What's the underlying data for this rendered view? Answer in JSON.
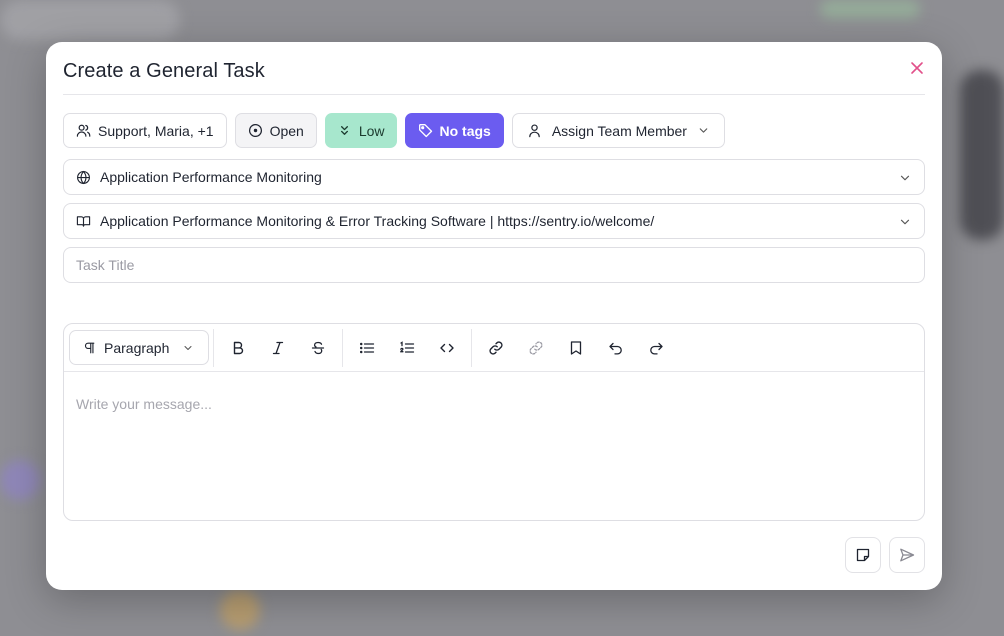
{
  "modal": {
    "title": "Create a General Task"
  },
  "chips": {
    "assignees": "Support, Maria, +1",
    "status": "Open",
    "priority": "Low",
    "tags": "No tags",
    "assign_member": "Assign Team Member"
  },
  "project_select": {
    "value": "Application Performance Monitoring",
    "icon": "globe-icon"
  },
  "source_select": {
    "value": "Application Performance Monitoring & Error Tracking Software | https://sentry.io/welcome/",
    "icon": "book-icon"
  },
  "task_title": {
    "placeholder": "Task Title",
    "value": ""
  },
  "editor": {
    "block_type": "Paragraph",
    "placeholder": "Write your message...",
    "toolbar_icons": [
      "bold-icon",
      "italic-icon",
      "strikethrough-icon",
      "bullet-list-icon",
      "ordered-list-icon",
      "code-icon",
      "link-icon",
      "unlink-icon",
      "bookmark-icon",
      "undo-icon",
      "redo-icon"
    ]
  },
  "colors": {
    "priority_low_bg": "#a7e7cd",
    "tags_bg": "#6b5cf0",
    "close_icon": "#e2508a"
  }
}
